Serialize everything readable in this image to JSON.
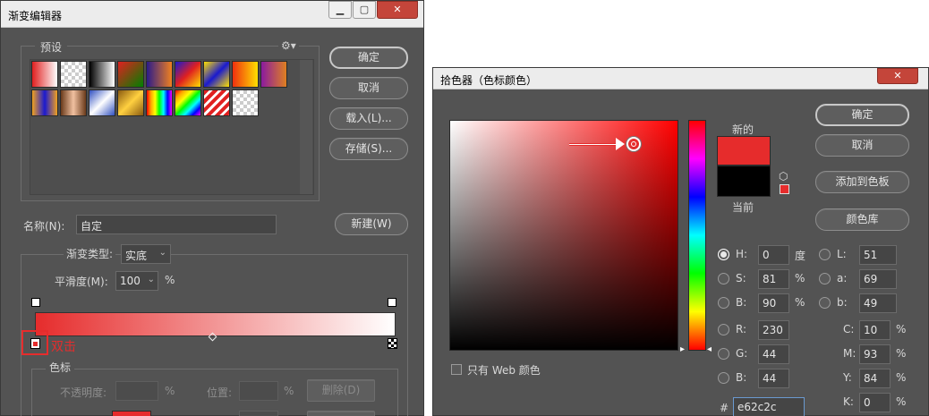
{
  "gradient_editor": {
    "title": "渐变编辑器",
    "presets_label": "预设",
    "buttons": {
      "ok": "确定",
      "cancel": "取消",
      "load": "载入(L)...",
      "save": "存储(S)...",
      "new": "新建(W)"
    },
    "name_label": "名称(N):",
    "name_value": "自定",
    "gradient_type_label": "渐变类型:",
    "gradient_type_value": "实底",
    "smoothness_label": "平滑度(M):",
    "smoothness_value": "100",
    "percent": "%",
    "annotation": "双击",
    "color_stops_label": "色标",
    "opacity_label": "不透明度:",
    "location_label": "位置:",
    "delete_label": "删除(D)",
    "gradient_colors": {
      "start": "#e62c2c",
      "end": "#ffffff"
    },
    "swatches": [
      "linear-gradient(90deg,#e02020,#fff)",
      "repeating-conic-gradient(#ccc 0 25%,#fff 0 50%) 0 0/8px 8px",
      "linear-gradient(90deg,#000,#fff)",
      "linear-gradient(135deg,#e02020,#008000)",
      "linear-gradient(90deg,#2b1b8a,#f08020)",
      "linear-gradient(135deg,#1a1acf,#e02020,#ffe000)",
      "linear-gradient(135deg,#ffe000,#1a1acf,#ffe000)",
      "linear-gradient(90deg,#f03010,#ffe000)",
      "linear-gradient(90deg,#8a1aa0,#e08020)",
      "linear-gradient(90deg,#f0a020,#1a1acf,#f0a020)",
      "linear-gradient(90deg,#6a3a1a,#f0c0a0,#6a3a1a)",
      "linear-gradient(135deg,#3050c0,#fff,#3050c0)",
      "linear-gradient(135deg,#8a5a10,#ffd040,#8a5a10)",
      "linear-gradient(90deg,red,orange,yellow,lime,cyan,blue,magenta)",
      "linear-gradient(135deg,red,orange,yellow,lime,cyan,blue,magenta)",
      "repeating-linear-gradient(135deg,#e02020 0 4px,#fff 4px 7px)",
      "repeating-conic-gradient(#ccc 0 25%,#fff 0 50%) 0 0/8px 8px"
    ]
  },
  "color_picker": {
    "title": "拾色器（色标颜色）",
    "buttons": {
      "ok": "确定",
      "cancel": "取消",
      "add_swatch": "添加到色板",
      "library": "颜色库"
    },
    "new_label": "新的",
    "current_label": "当前",
    "new_color": "#e62c2c",
    "current_color": "#000000",
    "hue_color": "#ff0000",
    "web_only_label": "只有 Web 颜色",
    "hsb": [
      {
        "k": "H:",
        "v": "0",
        "u": "度"
      },
      {
        "k": "S:",
        "v": "81",
        "u": "%"
      },
      {
        "k": "B:",
        "v": "90",
        "u": "%"
      }
    ],
    "rgb": [
      {
        "k": "R:",
        "v": "230"
      },
      {
        "k": "G:",
        "v": "44"
      },
      {
        "k": "B:",
        "v": "44"
      }
    ],
    "lab": [
      {
        "k": "L:",
        "v": "51"
      },
      {
        "k": "a:",
        "v": "69"
      },
      {
        "k": "b:",
        "v": "49"
      }
    ],
    "cmyk": [
      {
        "k": "C:",
        "v": "10",
        "u": "%"
      },
      {
        "k": "M:",
        "v": "93",
        "u": "%"
      },
      {
        "k": "Y:",
        "v": "84",
        "u": "%"
      },
      {
        "k": "K:",
        "v": "0",
        "u": "%"
      }
    ],
    "hex_label": "#",
    "hex_value": "e62c2c"
  }
}
